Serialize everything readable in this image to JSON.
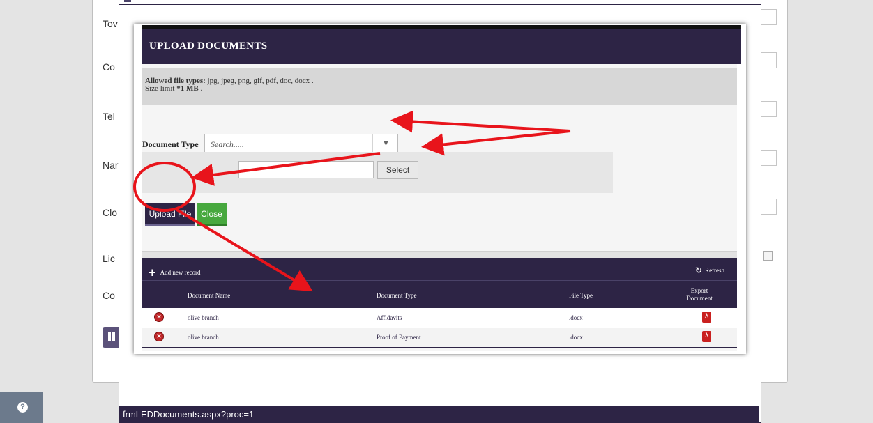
{
  "background": {
    "field_labels": [
      "Tov",
      "Co",
      "Tel",
      "Nar",
      "Clo",
      "Lic",
      "Co"
    ]
  },
  "help_icon": "question-circle-icon",
  "status_bar_text": "frmLEDDocuments.aspx?proc=1",
  "modal": {
    "title": "UPLOAD DOCUMENTS",
    "allowed_label": "Allowed file types:",
    "allowed_types": "jpg, jpeg, png, gif, pdf, doc, docx .",
    "size_label": "Size limit",
    "size_value": "*1 MB",
    "size_suffix": ".",
    "document_type_label": "Document Type",
    "document_type_placeholder": "Search.....",
    "select_button": "Select",
    "upload_button": "Upload File",
    "close_button": "Close"
  },
  "grid": {
    "add_label": "Add new record",
    "refresh_label": "Refresh",
    "columns": [
      "Document Name",
      "Document Type",
      "File Type",
      "Export",
      "Document"
    ],
    "rows": [
      {
        "name": "olive branch",
        "type": "Affidavits",
        "file_type": ".docx"
      },
      {
        "name": "olive branch",
        "type": "Proof of Payment",
        "file_type": ".docx"
      }
    ]
  },
  "colors": {
    "header": "#2d2445",
    "close_button": "#47a83e",
    "annotation": "#e8141b"
  }
}
